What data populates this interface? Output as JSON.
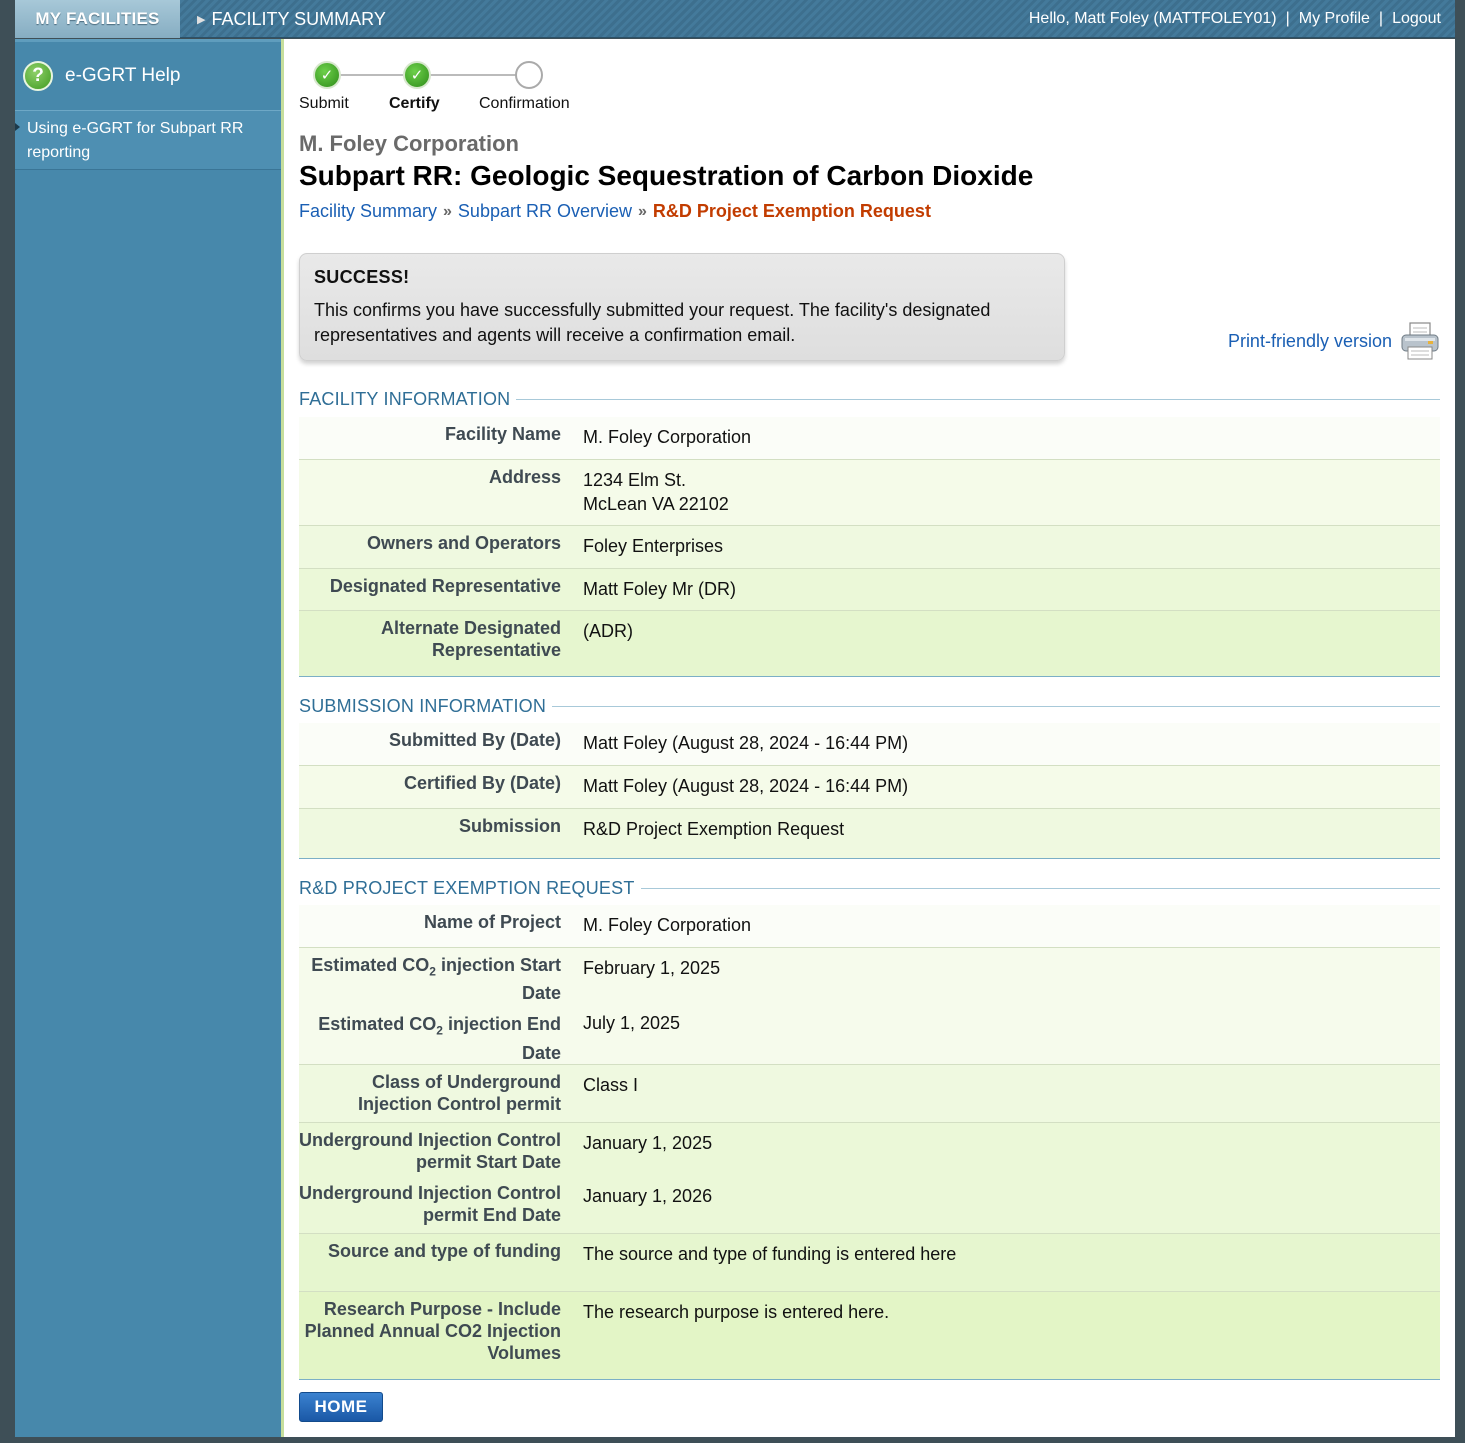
{
  "nav": {
    "my_facilities": "MY FACILITIES",
    "facility_summary": "FACILITY SUMMARY",
    "greeting": "Hello, Matt Foley (MATTFOLEY01)",
    "my_profile": "My Profile",
    "logout": "Logout",
    "sep1": "|",
    "sep2": "|"
  },
  "sidebar": {
    "help_icon": "?",
    "help_title": "e-GGRT Help",
    "help_link": "Using e-GGRT for Subpart RR reporting"
  },
  "steps": [
    {
      "label": "Submit",
      "status": "done"
    },
    {
      "label": "Certify",
      "status": "current"
    },
    {
      "label": "Confirmation",
      "status": "todo"
    }
  ],
  "page": {
    "organization": "M. Foley Corporation",
    "title": "Subpart RR: Geologic Sequestration of Carbon Dioxide",
    "breadcrumb": [
      "Facility Summary",
      "Subpart RR Overview",
      "R&D Project Exemption Request"
    ],
    "breadcrumb_sep": "»"
  },
  "success": {
    "heading": "SUCCESS!",
    "message": "This confirms you have successfully submitted your request. The facility's designated representatives and agents will receive a confirmation email."
  },
  "print_link": "Print-friendly version",
  "facility_info": {
    "title": "FACILITY INFORMATION",
    "rows": [
      {
        "label": "Facility Name",
        "value": "M. Foley Corporation"
      },
      {
        "label": "Address",
        "value": "1234 Elm St.",
        "value2": "McLean VA 22102"
      },
      {
        "label": "Owners and Operators",
        "value": "Foley Enterprises"
      },
      {
        "label": "Designated Representative",
        "value": "Matt Foley Mr (DR)"
      },
      {
        "label": "Alternate Designated Representative",
        "value": "(ADR)"
      }
    ]
  },
  "submission_info": {
    "title": "SUBMISSION INFORMATION",
    "rows": [
      {
        "label": "Submitted By (Date)",
        "value": "Matt Foley (August 28, 2024 - 16:44 PM)"
      },
      {
        "label": "Certified By (Date)",
        "value": "Matt Foley (August 28, 2024 - 16:44 PM)"
      },
      {
        "label": "Submission",
        "value": "R&D Project Exemption Request"
      }
    ]
  },
  "rd_request": {
    "title": "R&D PROJECT EXEMPTION REQUEST",
    "project_name_label": "Name of Project",
    "project_name": "M. Foley Corporation",
    "start_label_a": "Estimated CO",
    "start_label_sub": "2",
    "start_label_b": " injection Start Date",
    "start_value": "February 1, 2025",
    "end_label_a": "Estimated CO",
    "end_label_sub": "2",
    "end_label_b": " injection End Date",
    "end_value": "July 1, 2025",
    "class_label": "Class of Underground Injection Control permit",
    "class_value": "Class I",
    "uic_start_label": "Underground Injection Control permit Start Date",
    "uic_start_value": "January 1, 2025",
    "uic_end_label": "Underground Injection Control permit End Date",
    "uic_end_value": "January 1, 2026",
    "funding_label": "Source and type of funding",
    "funding_value": "The source and type of funding is entered here",
    "purpose_label": "Research Purpose - Include Planned Annual CO2 Injection Volumes",
    "purpose_value": "The research purpose is entered here."
  },
  "home_button": "HOME",
  "colors": {
    "accent_blue": "#1a5fb4",
    "breadcrumb_current": "#c23c00",
    "sidebar": "#4788ab",
    "row_tint": "#e4f6c4"
  }
}
